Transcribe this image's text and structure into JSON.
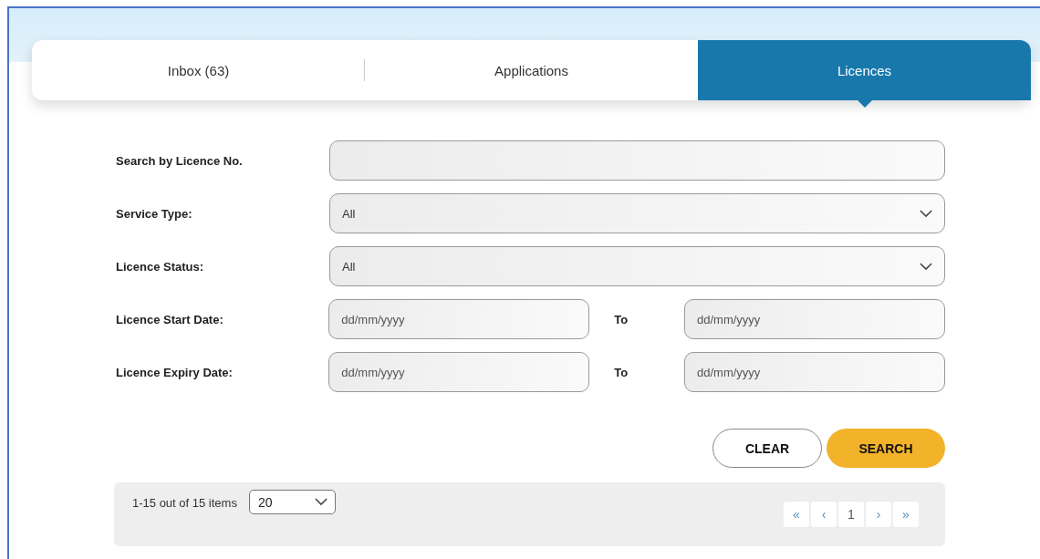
{
  "tabs": [
    {
      "label": "Inbox (63)",
      "selected": false
    },
    {
      "label": "Applications",
      "selected": false
    },
    {
      "label": "Licences",
      "selected": true
    }
  ],
  "form": {
    "rows": [
      {
        "kind": "text",
        "label": "Search by Licence No."
      },
      {
        "kind": "select",
        "label": "Service Type:",
        "value": "All"
      },
      {
        "kind": "select",
        "label": "Licence Status:",
        "value": "All"
      },
      {
        "kind": "range",
        "label": "Licence Start Date:",
        "from_placeholder": "dd/mm/yyyy",
        "to_label": "To",
        "to_placeholder": "dd/mm/yyyy"
      },
      {
        "kind": "range",
        "label": "Licence Expiry Date:",
        "from_placeholder": "dd/mm/yyyy",
        "to_label": "To",
        "to_placeholder": "dd/mm/yyyy"
      }
    ],
    "buttons": [
      {
        "label": "CLEAR",
        "kind": "secondary"
      },
      {
        "label": "SEARCH",
        "kind": "primary"
      }
    ]
  },
  "pager": {
    "summary": "1-15 out of 15 items",
    "page_size": "20",
    "controls": [
      {
        "label": "«",
        "kind": "nav"
      },
      {
        "label": "‹",
        "kind": "nav"
      },
      {
        "label": "1",
        "kind": "page"
      },
      {
        "label": "›",
        "kind": "nav"
      },
      {
        "label": "»",
        "kind": "nav"
      }
    ]
  }
}
